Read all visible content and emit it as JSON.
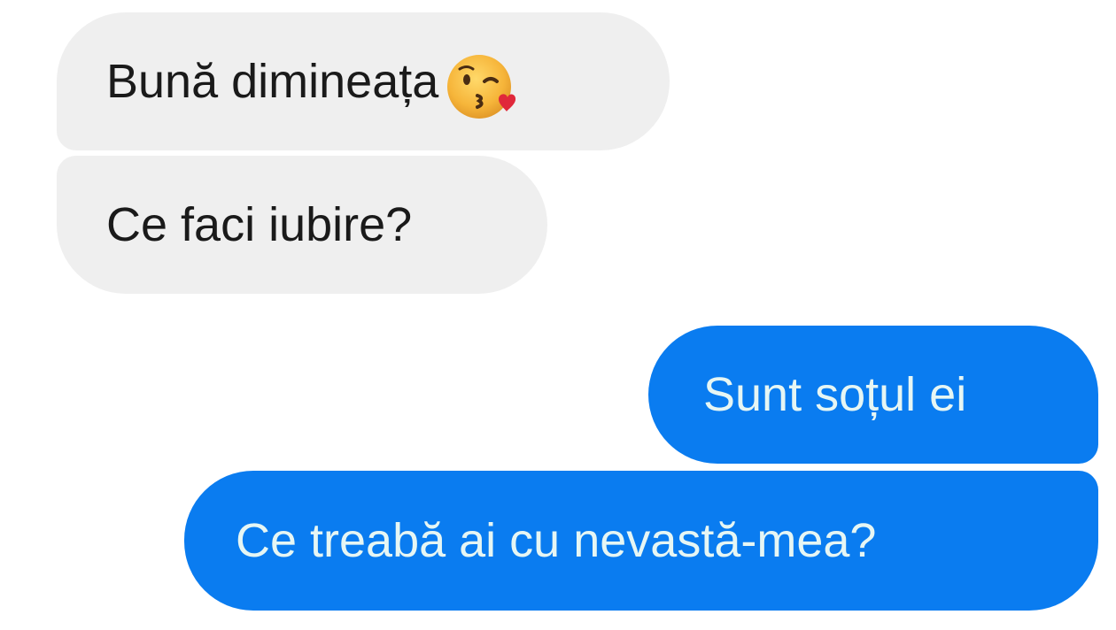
{
  "conversation": {
    "received": [
      {
        "text": "Bună dimineața",
        "emoji": "face-blowing-kiss-icon"
      },
      {
        "text": "Ce faci iubire?"
      }
    ],
    "sent": [
      {
        "text": "Sunt soțul ei"
      },
      {
        "text": "Ce treabă ai cu nevastă-mea?"
      }
    ]
  },
  "colors": {
    "received_bubble": "#efefef",
    "received_text": "#1a1a1a",
    "sent_bubble": "#0a7cf0",
    "sent_text": "#e6f6f4",
    "background": "#ffffff"
  }
}
